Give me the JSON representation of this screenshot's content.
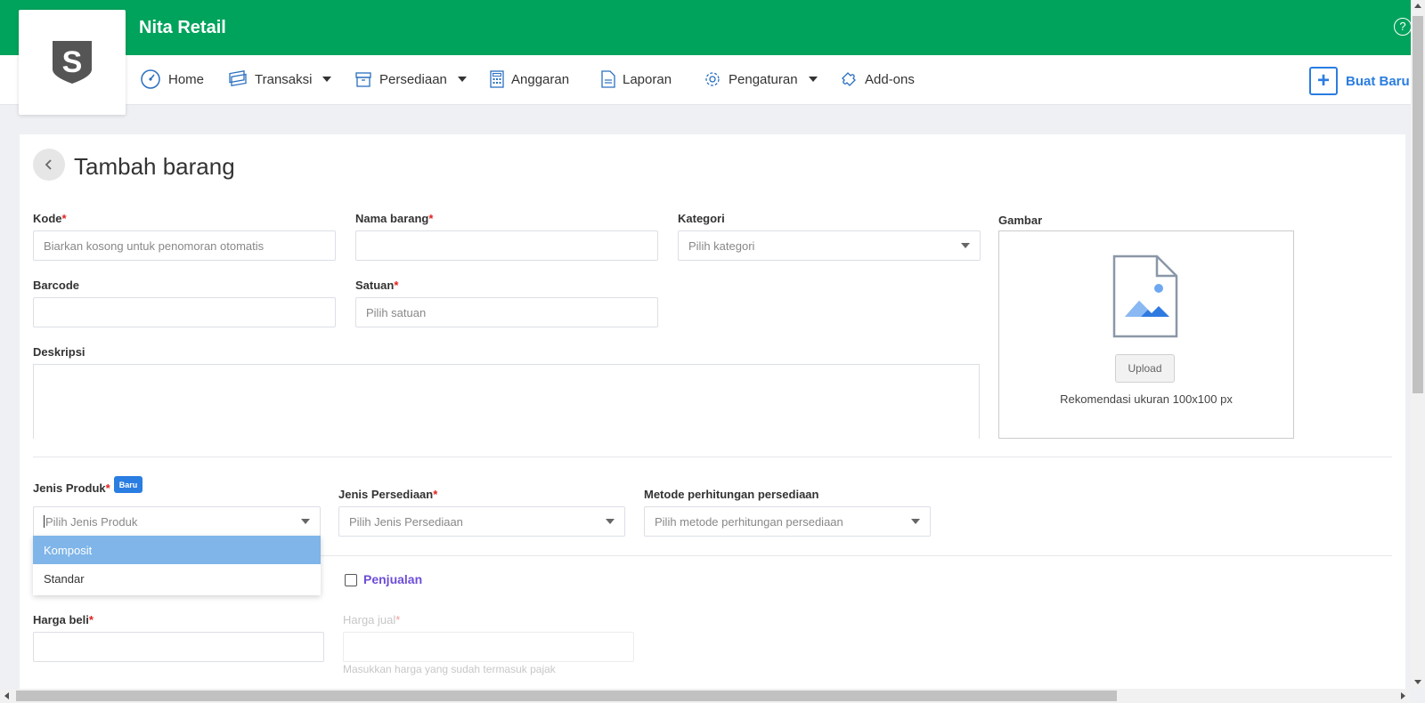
{
  "header": {
    "app_title": "Nita Retail",
    "help_glyph": "?",
    "brand_color": "#00a35c",
    "logo_letter": "S"
  },
  "nav": {
    "items": [
      {
        "label": "Home",
        "icon": "dashboard-icon",
        "has_caret": false
      },
      {
        "label": "Transaksi",
        "icon": "money-icon",
        "has_caret": true
      },
      {
        "label": "Persediaan",
        "icon": "box-icon",
        "has_caret": true
      },
      {
        "label": "Anggaran",
        "icon": "calculator-icon",
        "has_caret": false
      },
      {
        "label": "Laporan",
        "icon": "document-icon",
        "has_caret": false
      },
      {
        "label": "Pengaturan",
        "icon": "gear-icon",
        "has_caret": true
      },
      {
        "label": "Add-ons",
        "icon": "puzzle-icon",
        "has_caret": false
      }
    ],
    "create_button": "Buat Baru",
    "accent_color": "#2a7de1"
  },
  "page": {
    "title": "Tambah barang"
  },
  "form": {
    "kode": {
      "label": "Kode",
      "placeholder": "Biarkan kosong untuk penomoran otomatis"
    },
    "nama_barang": {
      "label": "Nama barang",
      "value": ""
    },
    "kategori": {
      "label": "Kategori",
      "placeholder": "Pilih kategori"
    },
    "barcode": {
      "label": "Barcode",
      "value": ""
    },
    "satuan": {
      "label": "Satuan",
      "placeholder": "Pilih satuan"
    },
    "deskripsi": {
      "label": "Deskripsi",
      "value": ""
    },
    "gambar": {
      "label": "Gambar",
      "upload_button": "Upload",
      "hint": "Rekomendasi ukuran 100x100 px"
    },
    "jenis_produk": {
      "label": "Jenis Produk",
      "badge": "Baru",
      "placeholder": "Pilih Jenis Produk",
      "options": [
        "Komposit",
        "Standar"
      ],
      "highlighted": "Komposit"
    },
    "jenis_persediaan": {
      "label": "Jenis Persediaan",
      "placeholder": "Pilih Jenis Persediaan"
    },
    "metode": {
      "label": "Metode perhitungan persediaan",
      "placeholder": "Pilih metode perhitungan persediaan"
    },
    "penjualan": {
      "label": "Penjualan",
      "checked": false
    },
    "harga_beli": {
      "label": "Harga beli",
      "value": ""
    },
    "harga_jual": {
      "label": "Harga jual",
      "hint": "Masukkan harga yang sudah termasuk pajak"
    },
    "required_mark": "*"
  }
}
